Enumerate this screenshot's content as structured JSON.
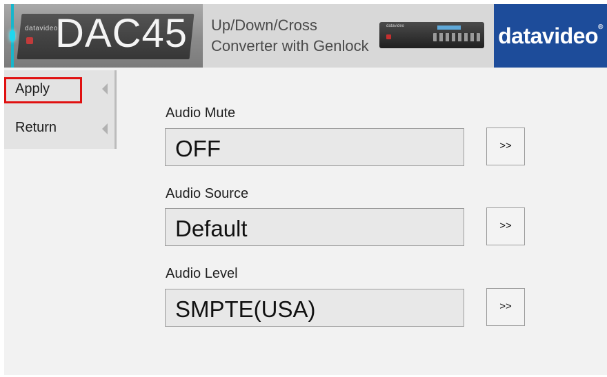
{
  "header": {
    "model": "DAC45",
    "mini_logo": "datavideo",
    "subtitle_line1": "Up/Down/Cross",
    "subtitle_line2": "Converter with Genlock",
    "brand": "datavideo",
    "brand_mark": "®",
    "accent_color": "#17b6cc",
    "brand_bg": "#1d4c9a"
  },
  "sidebar": {
    "items": [
      {
        "label": "Apply",
        "highlighted": true
      },
      {
        "label": "Return",
        "highlighted": false
      }
    ],
    "arrow_icon": "triangle-left-icon",
    "highlight_color": "#e01010"
  },
  "form": {
    "fields": [
      {
        "label": "Audio Mute",
        "value": "OFF",
        "button": ">>"
      },
      {
        "label": "Audio Source",
        "value": "Default",
        "button": ">>"
      },
      {
        "label": "Audio Level",
        "value": "SMPTE(USA)",
        "button": ">>"
      }
    ]
  }
}
